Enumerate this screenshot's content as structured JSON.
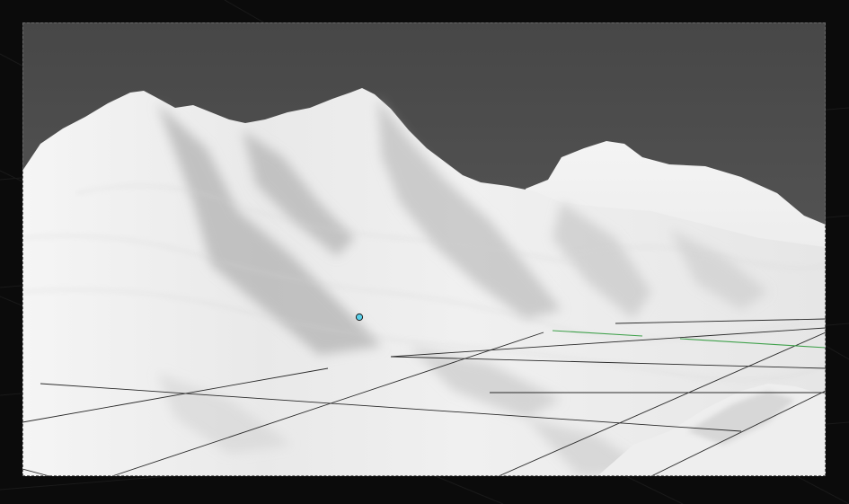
{
  "viewport": {
    "mode": "rendered",
    "background_color": "#0b0b0b",
    "sky_color": "#4f4f4f",
    "terrain_color": "#f2f2f2",
    "grid_color": "#1c1c1c",
    "axis_color": "#3ea04a",
    "cursor_color": "#5ad0ea",
    "border_style": "dashed"
  },
  "icons": {
    "origin_marker": "3d-cursor-icon"
  }
}
